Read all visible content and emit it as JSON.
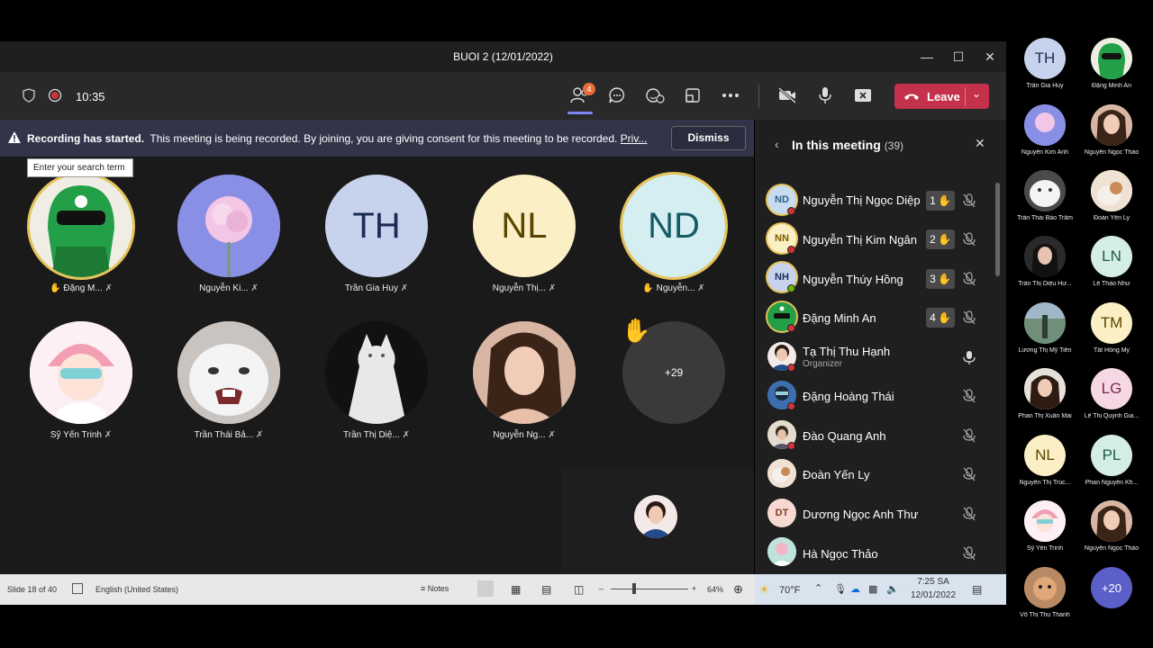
{
  "window": {
    "title": "BUOI 2 (12/01/2022)"
  },
  "toolbar": {
    "time": "10:35",
    "participants_badge": "4",
    "leave_label": "Leave"
  },
  "banner": {
    "title": "Recording has started.",
    "message": "This meeting is being recorded. By joining, you are giving consent for this meeting to be recorded.",
    "privacy_link": "Priv...",
    "dismiss_label": "Dismiss"
  },
  "search": {
    "placeholder": "Enter your search term"
  },
  "stage": {
    "tiles": [
      {
        "name": "Đặng M...",
        "initials": "",
        "raised": true
      },
      {
        "name": "Nguyễn Ki...",
        "initials": ""
      },
      {
        "name": "Trần Gia Huy",
        "initials": "TH"
      },
      {
        "name": "Nguyễn Thị...",
        "initials": "NL"
      },
      {
        "name": "Nguyễn...",
        "initials": "ND",
        "raised": true
      },
      {
        "name": "Sỹ Yến Trinh",
        "initials": ""
      },
      {
        "name": "Trần Thái Bả...",
        "initials": ""
      },
      {
        "name": "Trần Thị Diệ...",
        "initials": ""
      },
      {
        "name": "Nguyễn Ng...",
        "initials": ""
      }
    ],
    "overflow": "+29"
  },
  "panel": {
    "title": "In this meeting",
    "count": "(39)",
    "people": [
      {
        "initials": "ND",
        "name": "Nguyễn Thị Ngọc Diệp",
        "hand": "1"
      },
      {
        "initials": "NN",
        "name": "Nguyễn Thị Kim Ngân",
        "hand": "2"
      },
      {
        "initials": "NH",
        "name": "Nguyễn Thúy Hồng",
        "hand": "3"
      },
      {
        "initials": "",
        "name": "Đặng Minh An",
        "hand": "4"
      },
      {
        "initials": "",
        "name": "Tạ Thị Thu Hạnh",
        "role": "Organizer"
      },
      {
        "initials": "",
        "name": "Đặng Hoàng Thái"
      },
      {
        "initials": "",
        "name": "Đào Quang Anh"
      },
      {
        "initials": "",
        "name": "Đoàn Yến Ly"
      },
      {
        "initials": "DT",
        "name": "Dương Ngọc Anh Thư"
      },
      {
        "initials": "",
        "name": "Hà Ngọc Thảo"
      }
    ]
  },
  "taskbar": {
    "slide": "Slide 18 of 40",
    "language": "English (United States)",
    "notes": "Notes",
    "zoom": "64%",
    "weather": "70°F",
    "clock_time": "7:25 SA",
    "clock_date": "12/01/2022"
  },
  "gallery": {
    "items": [
      {
        "initials": "TH",
        "name": "Trần Gia Huy"
      },
      {
        "initials": "",
        "name": "Đặng Minh An"
      },
      {
        "initials": "",
        "name": "Nguyễn Kim Anh"
      },
      {
        "initials": "",
        "name": "Nguyễn Ngọc Thảo"
      },
      {
        "initials": "",
        "name": "Trần Thái Bảo Trâm"
      },
      {
        "initials": "",
        "name": "Đoàn Yến Ly"
      },
      {
        "initials": "",
        "name": "Trần Thị Diệu Hư..."
      },
      {
        "initials": "LN",
        "name": "Lê Thảo Như"
      },
      {
        "initials": "",
        "name": "Lương Thị Mỹ Tiên"
      },
      {
        "initials": "TM",
        "name": "Tất Hồng My"
      },
      {
        "initials": "",
        "name": "Phan Thị Xuân Mai"
      },
      {
        "initials": "LG",
        "name": "Lê Thị Quỳnh Gia..."
      },
      {
        "initials": "NL",
        "name": "Nguyễn Thị Trúc..."
      },
      {
        "initials": "PL",
        "name": "Phan Nguyễn Kh..."
      },
      {
        "initials": "",
        "name": "Sỹ Yến Trinh"
      },
      {
        "initials": "",
        "name": "Nguyễn Ngọc Thảo"
      },
      {
        "initials": "",
        "name": "Võ Thị Thu Thanh"
      },
      {
        "initials": "+20",
        "name": ""
      }
    ]
  },
  "colors": {
    "accent": "#6264a7",
    "leave": "#c4314b",
    "hand": "#f7c04a",
    "muted": "#9a9a9a"
  }
}
